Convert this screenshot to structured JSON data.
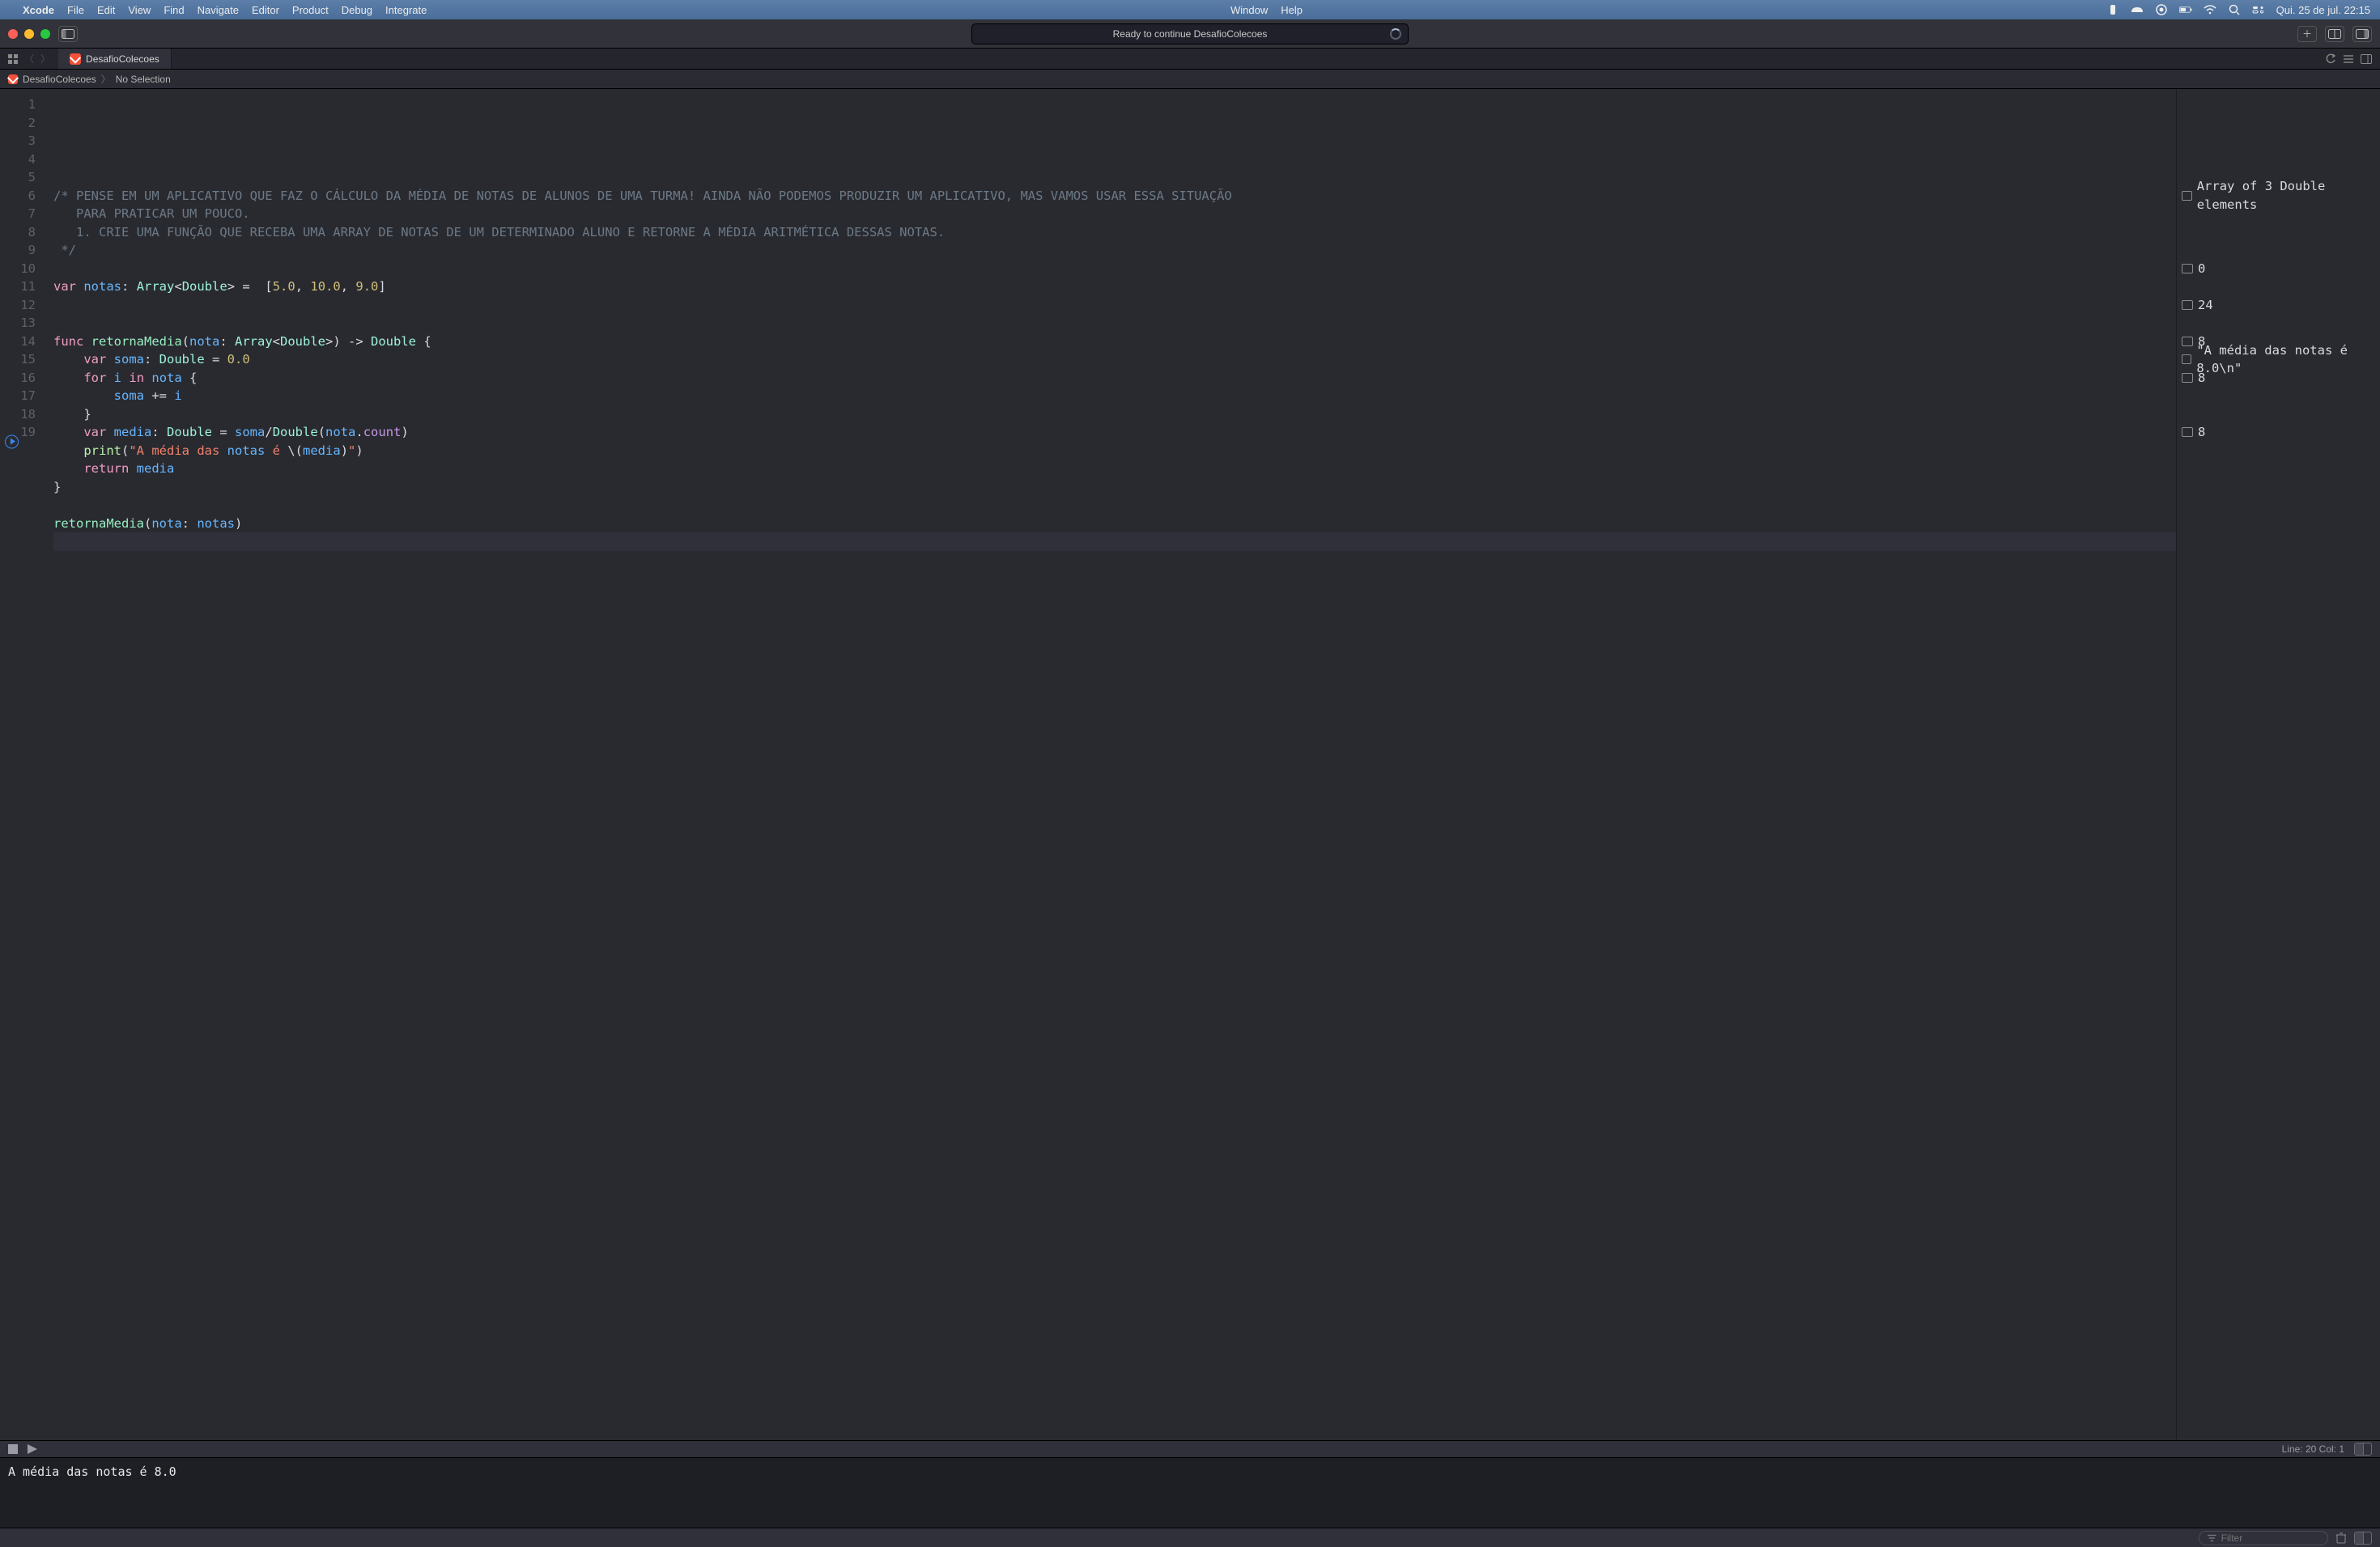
{
  "menubar": {
    "app": "Xcode",
    "items": [
      "File",
      "Edit",
      "View",
      "Find",
      "Navigate",
      "Editor",
      "Product",
      "Debug",
      "Integrate"
    ],
    "right_items": [
      "Window",
      "Help"
    ],
    "clock": "Qui. 25 de jul.  22:15"
  },
  "toolbar": {
    "status": "Ready to continue DesafioColecoes"
  },
  "tab": {
    "name": "DesafioColecoes"
  },
  "breadcrumb": {
    "project": "DesafioColecoes",
    "selection": "No Selection"
  },
  "code": {
    "lines": [
      "/* PENSE EM UM APLICATIVO QUE FAZ O CÁLCULO DA MÉDIA DE NOTAS DE ALUNOS DE UMA TURMA! AINDA NÃO PODEMOS PRODUZIR UM APLICATIVO, MAS VAMOS USAR ESSA SITUAÇÃO",
      "   PARA PRATICAR UM POUCO.",
      "   1. CRIE UMA FUNÇÃO QUE RECEBA UMA ARRAY DE NOTAS DE UM DETERMINADO ALUNO E RETORNE A MÉDIA ARITMÉTICA DESSAS NOTAS.",
      " */",
      "",
      "var notas: Array<Double> =  [5.0, 10.0, 9.0]",
      "",
      "",
      "func retornaMedia(nota: Array<Double>) -> Double {",
      "    var soma: Double = 0.0",
      "    for i in nota {",
      "        soma += i",
      "    }",
      "    var media: Double = soma/Double(nota.count)",
      "    print(\"A média das notas é \\(media)\")",
      "    return media",
      "}",
      "",
      "retornaMedia(nota: notas)",
      ""
    ],
    "gutter_numbers": [
      "1",
      "2",
      "3",
      "4",
      "5",
      "6",
      "7",
      "8",
      "9",
      "10",
      "11",
      "12",
      "13",
      "14",
      "15",
      "16",
      "17",
      "18",
      "19",
      ""
    ]
  },
  "results": {
    "r6": "Array of 3 Double elements",
    "r10": "0",
    "r12": "24",
    "r14": "8",
    "r15": "\"A média das notas é 8.0\\n\"",
    "r16": "8",
    "r19": "8"
  },
  "debugbar": {
    "cursor": "Line: 20  Col: 1"
  },
  "console": {
    "output": "A média das notas é 8.0"
  },
  "console_footer": {
    "filter_placeholder": "Filter"
  }
}
